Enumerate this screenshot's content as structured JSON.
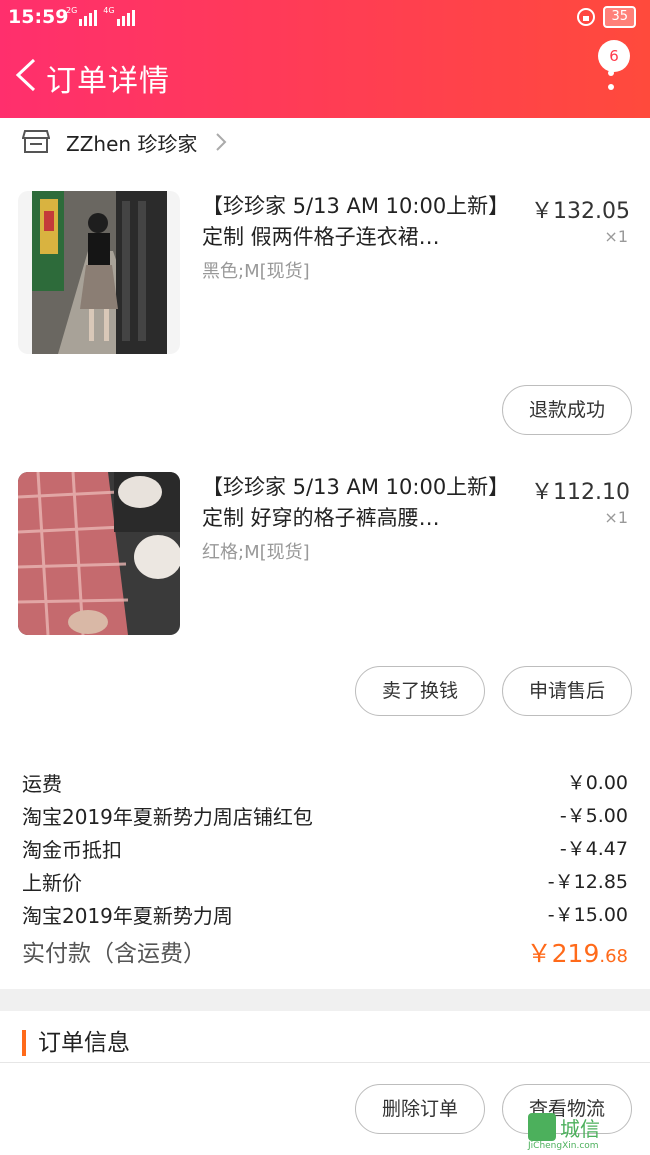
{
  "status_bar": {
    "time": "15:59",
    "net1": "2G",
    "net2": "4G",
    "battery": "35"
  },
  "header": {
    "title": "订单详情",
    "badge": "6"
  },
  "shop": {
    "name": "ZZhen 珍珍家"
  },
  "items": [
    {
      "title": "【珍珍家 5/13 AM 10:00上新】定制 假两件格子连衣裙…",
      "sku": "黑色;M[现货]",
      "price": "￥132.05",
      "qty": "×1",
      "buttons": [
        "退款成功"
      ]
    },
    {
      "title": "【珍珍家 5/13 AM 10:00上新】定制 好穿的格子裤高腰…",
      "sku": "红格;M[现货]",
      "price": "￥112.10",
      "qty": "×1",
      "buttons": [
        "卖了换钱",
        "申请售后"
      ]
    }
  ],
  "fees": [
    {
      "label": "运费",
      "value": "￥0.00"
    },
    {
      "label": "淘宝2019年夏新势力周店铺红包",
      "value": "-￥5.00"
    },
    {
      "label": "淘金币抵扣",
      "value": "-￥4.47"
    },
    {
      "label": "上新价",
      "value": "-￥12.85"
    },
    {
      "label": "淘宝2019年夏新势力周",
      "value": "-￥15.00"
    }
  ],
  "total": {
    "label": "实付款（含运费）",
    "main": "￥219",
    "cents": ".68"
  },
  "order_info": {
    "title": "订单信息"
  },
  "bottom_bar": {
    "delete_label": "删除订单",
    "logistics_label": "查看物流"
  },
  "watermark": {
    "text": "城信",
    "sub": "JiChengXin.com"
  },
  "colors": {
    "header_start": "#ff2f6d",
    "header_end": "#ff4a3c",
    "price_accent": "#ff6a1a"
  }
}
